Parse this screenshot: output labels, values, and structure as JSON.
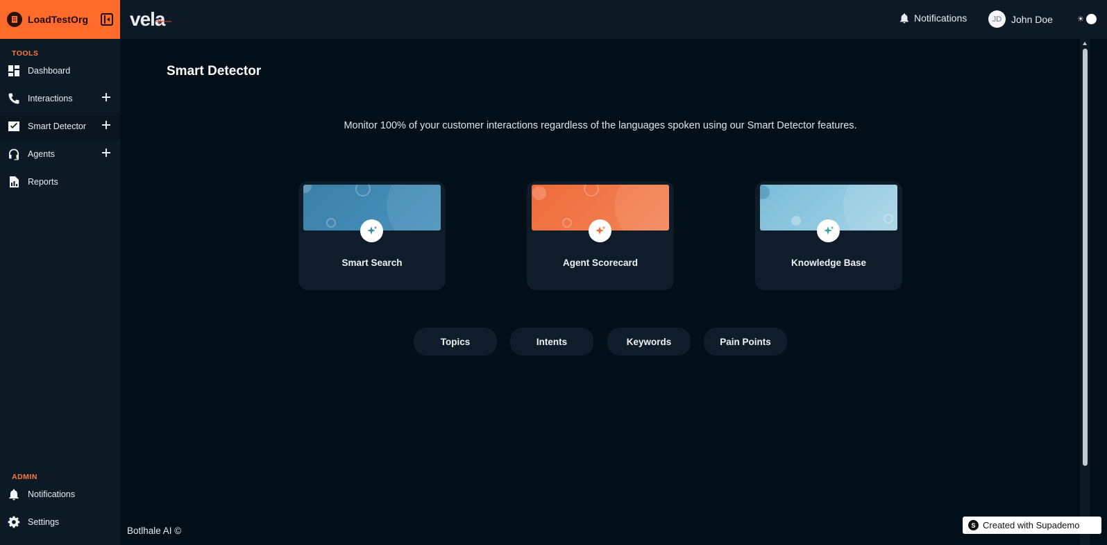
{
  "sidebar": {
    "org_name": "LoadTestOrg",
    "tools_label": "TOOLS",
    "tools": [
      {
        "label": "Dashboard",
        "icon": "dashboard-icon"
      },
      {
        "label": "Interactions",
        "icon": "phone-icon",
        "expandable": true
      },
      {
        "label": "Smart Detector",
        "icon": "detector-icon",
        "expandable": true,
        "active": true
      },
      {
        "label": "Agents",
        "icon": "headset-icon",
        "expandable": true
      },
      {
        "label": "Reports",
        "icon": "report-icon"
      }
    ],
    "admin_label": "ADMIN",
    "admin": [
      {
        "label": "Notifications",
        "icon": "bell-icon"
      },
      {
        "label": "Settings",
        "icon": "gear-icon"
      }
    ]
  },
  "header": {
    "brand": "vela",
    "notifications_label": "Notifications",
    "user_initials": "JD",
    "user_name": "John Doe",
    "theme_icon": "☀"
  },
  "main": {
    "title": "Smart Detector",
    "subtitle": "Monitor 100% of your customer interactions regardless of the languages spoken using our Smart Detector features.",
    "cards": [
      {
        "label": "Smart Search",
        "color": "#3d84ad",
        "accent": "#3b88b0"
      },
      {
        "label": "Agent Scorecard",
        "color": "#f07a4a",
        "accent": "#f26b30"
      },
      {
        "label": "Knowledge Base",
        "color": "#8bc4dc",
        "accent": "#3aa6a0"
      }
    ],
    "pills": [
      "Topics",
      "Intents",
      "Keywords",
      "Pain Points"
    ]
  },
  "footer": {
    "copyright": "Botlhale AI ©",
    "supademo_label": "Created with Supademo",
    "supademo_logo": "S"
  }
}
